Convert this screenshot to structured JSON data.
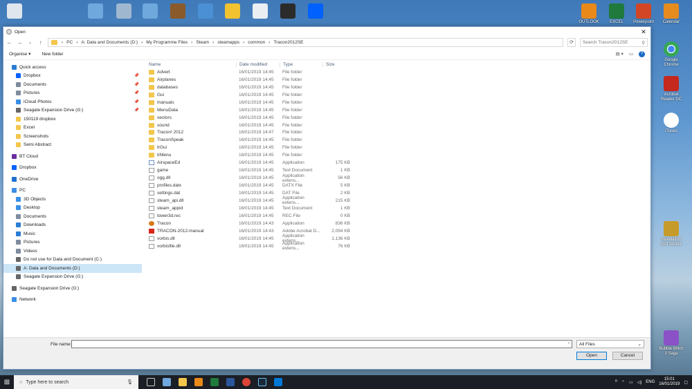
{
  "desktop": {
    "icons": [
      {
        "label": "OUTLOOK",
        "color": "#e8891a"
      },
      {
        "label": "EXCEL",
        "color": "#1f7a3c"
      },
      {
        "label": "Powerpoint",
        "color": "#d24625"
      },
      {
        "label": "Calendar",
        "color": "#e68c1e"
      },
      {
        "label": "Google Chrome",
        "color": "#e0e0e0"
      },
      {
        "label": "Acrobat Reader DC",
        "color": "#c5281c"
      },
      {
        "label": "iTunes",
        "color": "#ffffff"
      },
      {
        "label": "Revelation UCI Server",
        "color": "#c79b2b"
      },
      {
        "label": "Bubble Witch 3 Saga",
        "color": "#8a52c6"
      }
    ]
  },
  "dialog": {
    "title": "Open",
    "breadcrumb": [
      "PC",
      "A: Data and Documents (D:)",
      "My Programme Files",
      "Steam",
      "steamapps",
      "common",
      "Tracon2012SE"
    ],
    "search_placeholder": "Search Tracon2012SE",
    "toolbar": {
      "organise": "Organise ▾",
      "new_folder": "New folder",
      "help": "?"
    },
    "columns": {
      "name": "Name",
      "date": "Date modified",
      "type": "Type",
      "size": "Size"
    },
    "nav": [
      {
        "label": "Quick access",
        "level": 1,
        "color": "#2b7cd3"
      },
      {
        "label": "Dropbox",
        "level": 2,
        "color": "#0061fe",
        "pinned": true
      },
      {
        "label": "Documents",
        "level": 2,
        "color": "#7f8c9d",
        "pinned": true
      },
      {
        "label": "Pictures",
        "level": 2,
        "color": "#7f8c9d",
        "pinned": true
      },
      {
        "label": "iCloud Photos",
        "level": 2,
        "color": "#3a8ee6",
        "pinned": true
      },
      {
        "label": "Seagate Expansion Drive (G:)",
        "level": 2,
        "color": "#666666",
        "pinned": true
      },
      {
        "label": "150119 dropbox",
        "level": 2,
        "color": "#f3c64c"
      },
      {
        "label": "Excel",
        "level": 2,
        "color": "#f3c64c"
      },
      {
        "label": "Screenshots",
        "level": 2,
        "color": "#f3c64c"
      },
      {
        "label": "Semi Abstract",
        "level": 2,
        "color": "#f3c64c"
      },
      {
        "gap": true
      },
      {
        "label": "BT Cloud",
        "level": 1,
        "color": "#6b2fa0"
      },
      {
        "gap": true
      },
      {
        "label": "Dropbox",
        "level": 1,
        "color": "#0061fe"
      },
      {
        "gap": true
      },
      {
        "label": "OneDrive",
        "level": 1,
        "color": "#1e6fd0"
      },
      {
        "gap": true
      },
      {
        "label": "PC",
        "level": 1,
        "color": "#3a8ee6"
      },
      {
        "label": "3D Objects",
        "level": 2,
        "color": "#3a8ee6"
      },
      {
        "label": "Desktop",
        "level": 2,
        "color": "#3a8ee6"
      },
      {
        "label": "Documents",
        "level": 2,
        "color": "#7f8c9d"
      },
      {
        "label": "Downloads",
        "level": 2,
        "color": "#2b7cd3"
      },
      {
        "label": "Music",
        "level": 2,
        "color": "#2b7cd3"
      },
      {
        "label": "Pictures",
        "level": 2,
        "color": "#7f8c9d"
      },
      {
        "label": "Videos",
        "level": 2,
        "color": "#7f8c9d"
      },
      {
        "label": "Do not use for Data and Document (C:)",
        "level": 2,
        "color": "#666666"
      },
      {
        "label": "A: Data and Documents (D:)",
        "level": 2,
        "color": "#666666",
        "selected": true
      },
      {
        "label": "Seagate Expansion Drive (G:)",
        "level": 2,
        "color": "#666666"
      },
      {
        "gap": true
      },
      {
        "label": "Seagate Expansion Drive (G:)",
        "level": 1,
        "color": "#666666"
      },
      {
        "gap": true
      },
      {
        "label": "Network",
        "level": 1,
        "color": "#3a8ee6"
      }
    ],
    "files": [
      {
        "name": "Advert",
        "date": "16/01/2019 14:45",
        "type": "File folder",
        "size": "",
        "icon": "folder"
      },
      {
        "name": "Airplanes",
        "date": "16/01/2019 14:45",
        "type": "File folder",
        "size": "",
        "icon": "folder"
      },
      {
        "name": "databases",
        "date": "16/01/2019 14:45",
        "type": "File folder",
        "size": "",
        "icon": "folder"
      },
      {
        "name": "Gui",
        "date": "16/01/2019 14:45",
        "type": "File folder",
        "size": "",
        "icon": "folder"
      },
      {
        "name": "manuals",
        "date": "16/01/2019 14:45",
        "type": "File folder",
        "size": "",
        "icon": "folder"
      },
      {
        "name": "MenuData",
        "date": "16/01/2019 14:45",
        "type": "File folder",
        "size": "",
        "icon": "folder"
      },
      {
        "name": "sectors",
        "date": "16/01/2019 14:45",
        "type": "File folder",
        "size": "",
        "icon": "folder"
      },
      {
        "name": "sound",
        "date": "16/01/2019 14:45",
        "type": "File folder",
        "size": "",
        "icon": "folder"
      },
      {
        "name": "Tracon! 2012",
        "date": "16/01/2019 14:47",
        "type": "File folder",
        "size": "",
        "icon": "folder"
      },
      {
        "name": "TraconSpeak",
        "date": "16/01/2019 14:45",
        "type": "File folder",
        "size": "",
        "icon": "folder"
      },
      {
        "name": "trGui",
        "date": "16/01/2019 14:45",
        "type": "File folder",
        "size": "",
        "icon": "folder"
      },
      {
        "name": "trMenu",
        "date": "16/01/2019 14:45",
        "type": "File folder",
        "size": "",
        "icon": "folder"
      },
      {
        "name": "AirspaceEd",
        "date": "16/01/2019 14:45",
        "type": "Application",
        "size": "175 KB",
        "icon": "app"
      },
      {
        "name": "game",
        "date": "16/01/2019 14:45",
        "type": "Text Document",
        "size": "1 KB",
        "icon": "doc"
      },
      {
        "name": "ogg.dll",
        "date": "16/01/2019 14:45",
        "type": "Application extens...",
        "size": "56 KB",
        "icon": "doc"
      },
      {
        "name": "profiles.datx",
        "date": "16/01/2019 14:45",
        "type": "DATX File",
        "size": "5 KB",
        "icon": "doc"
      },
      {
        "name": "settings.dat",
        "date": "16/01/2019 14:45",
        "type": "DAT File",
        "size": "2 KB",
        "icon": "doc"
      },
      {
        "name": "steam_api.dll",
        "date": "16/01/2019 14:45",
        "type": "Application extens...",
        "size": "215 KB",
        "icon": "doc"
      },
      {
        "name": "steam_appid",
        "date": "16/01/2019 14:45",
        "type": "Text Document",
        "size": "1 KB",
        "icon": "doc"
      },
      {
        "name": "tower3d.rec",
        "date": "16/01/2019 14:45",
        "type": "REC File",
        "size": "0 KB",
        "icon": "doc"
      },
      {
        "name": "Tracon",
        "date": "16/01/2019 14:43",
        "type": "Application",
        "size": "836 KB",
        "icon": "tracon"
      },
      {
        "name": "TRACON-2012-manual",
        "date": "16/01/2019 14:43",
        "type": "Adobe Acrobat D...",
        "size": "2,094 KB",
        "icon": "pdf"
      },
      {
        "name": "vorbis.dll",
        "date": "16/01/2019 14:45",
        "type": "Application extens...",
        "size": "1,136 KB",
        "icon": "doc"
      },
      {
        "name": "vorbisfile.dll",
        "date": "16/01/2019 14:45",
        "type": "Application extens...",
        "size": "76 KB",
        "icon": "doc"
      }
    ],
    "footer": {
      "file_name_label": "File name:",
      "file_name_value": "",
      "filter": "All Files",
      "open": "Open",
      "cancel": "Cancel"
    }
  },
  "taskbar": {
    "search_placeholder": "Type here to search",
    "tray_lang": "ENG",
    "time": "15:01",
    "date": "16/01/2019"
  }
}
